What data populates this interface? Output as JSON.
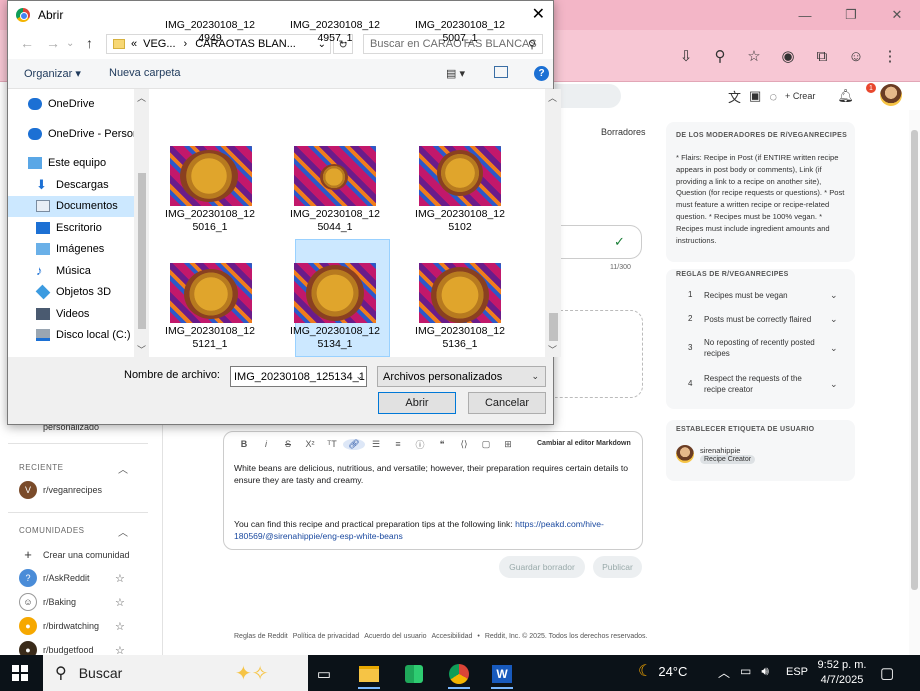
{
  "dialog": {
    "title": "Abrir",
    "breadcrumb_prefix": "«",
    "breadcrumb_1": "VEG...",
    "breadcrumb_sep": "›",
    "breadcrumb_2": "CARAOTAS BLAN...",
    "search_placeholder": "Buscar en CARAOTAS BLANCAS",
    "organize": "Organizar",
    "new_folder": "Nueva carpeta",
    "nav_items": [
      "OneDrive",
      "OneDrive - Person",
      "Este equipo",
      "Descargas",
      "Documentos",
      "Escritorio",
      "Imágenes",
      "Música",
      "Objetos 3D",
      "Videos",
      "Disco local (C:)"
    ],
    "files_row0": [
      {
        "l1": "IMG_20230108_12",
        "l2": "4949"
      },
      {
        "l1": "IMG_20230108_12",
        "l2": "4957_1"
      },
      {
        "l1": "IMG_20230108_12",
        "l2": "5007_1"
      }
    ],
    "files_row1": [
      {
        "l1": "IMG_20230108_12",
        "l2": "5016_1"
      },
      {
        "l1": "IMG_20230108_12",
        "l2": "5044_1"
      },
      {
        "l1": "IMG_20230108_12",
        "l2": "5102"
      }
    ],
    "files_row2": [
      {
        "l1": "IMG_20230108_12",
        "l2": "5121_1"
      },
      {
        "l1": "IMG_20230108_12",
        "l2": "5134_1"
      },
      {
        "l1": "IMG_20230108_12",
        "l2": "5136_1"
      }
    ],
    "filename_label": "Nombre de archivo:",
    "filename_value": "IMG_20230108_125134_1",
    "filetype": "Archivos personalizados",
    "open_btn": "Abrir",
    "cancel_btn": "Cancelar"
  },
  "reddit": {
    "create": "Crear",
    "notif_count": "1",
    "drafts": "Borradores",
    "title_count": "11/300",
    "editor_switch": "Cambiar al editor Markdown",
    "body_p1": "White beans are delicious, nutritious, and versatile; however, their preparation requires certain details to ensure they are tasty and creamy.",
    "body_p2_text": "You can find this recipe and practical preparation tips at the following link: ",
    "body_p2_link": "https://peakd.com/hive-180569/@sirenahippie/eng-esp-white-beans",
    "save_draft": "Guardar borrador",
    "publish": "Publicar",
    "footer": [
      "Reglas de Reddit",
      "Política de privacidad",
      "Acuerdo del usuario",
      "Accesibilidad",
      "Reddit, Inc. © 2025. Todos los derechos reservados."
    ],
    "sidebar": {
      "custom_tail": "personalizado",
      "recent_head": "RECIENTE",
      "recent_item": "r/veganrecipes",
      "communities_head": "COMUNIDADES",
      "create_community": "Crear una comunidad",
      "communities": [
        "r/AskReddit",
        "r/Baking",
        "r/birdwatching",
        "r/budgetfood"
      ]
    },
    "mods_head": "DE LOS MODERADORES DE R/VEGANRECIPES",
    "mods_text": "* Flairs: Recipe in Post (if ENTIRE written recipe appears in post body or comments), Link (if providing a link to a recipe on another site), Question (for recipe requests or questions). * Post must feature a written recipe or recipe-related question. * Recipes must be 100% vegan. * Recipes must include ingredient amounts and instructions.",
    "rules_head": "REGLAS DE R/VEGANRECIPES",
    "rules": [
      {
        "n": "1",
        "t": "Recipes must be vegan"
      },
      {
        "n": "2",
        "t": "Posts must be correctly flaired"
      },
      {
        "n": "3",
        "t": "No reposting of recently posted recipes"
      },
      {
        "n": "4",
        "t": "Respect the requests of the recipe creator"
      }
    ],
    "flair_head": "ESTABLECER ETIQUETA DE USUARIO",
    "flair_user": "sirenahippie",
    "flair_badge": "Recipe Creator"
  },
  "taskbar": {
    "search": "Buscar",
    "temp": "24°C",
    "lang": "ESP",
    "time": "9:52 p. m.",
    "date": "4/7/2025"
  },
  "colors": {
    "accent": "#0078d7",
    "selection": "#cce8ff",
    "chrome_pink": "#f7c7d4"
  }
}
